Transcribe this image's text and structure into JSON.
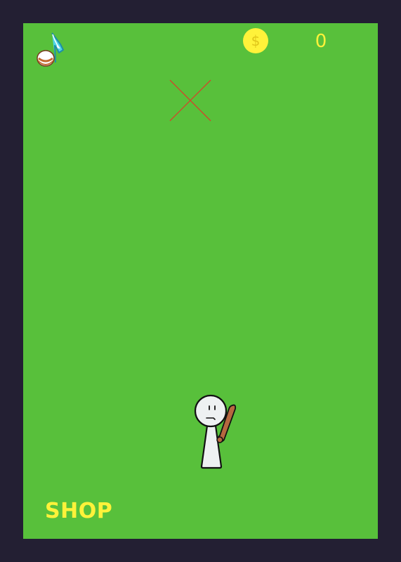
{
  "hud": {
    "music_icon": "music-note-icon",
    "coin_icon": "dollar-coin-icon",
    "coin_symbol": "$",
    "coin_count": "0"
  },
  "game": {
    "target_icon": "target-x-icon",
    "player_icon": "stick-figure-with-bat-icon"
  },
  "menu": {
    "shop_label": "SHOP"
  },
  "colors": {
    "background": "#231f33",
    "field": "#58c03b",
    "accent_yellow": "#fff23a",
    "target_red": "#d2452a",
    "bat_brown": "#b6683f"
  }
}
